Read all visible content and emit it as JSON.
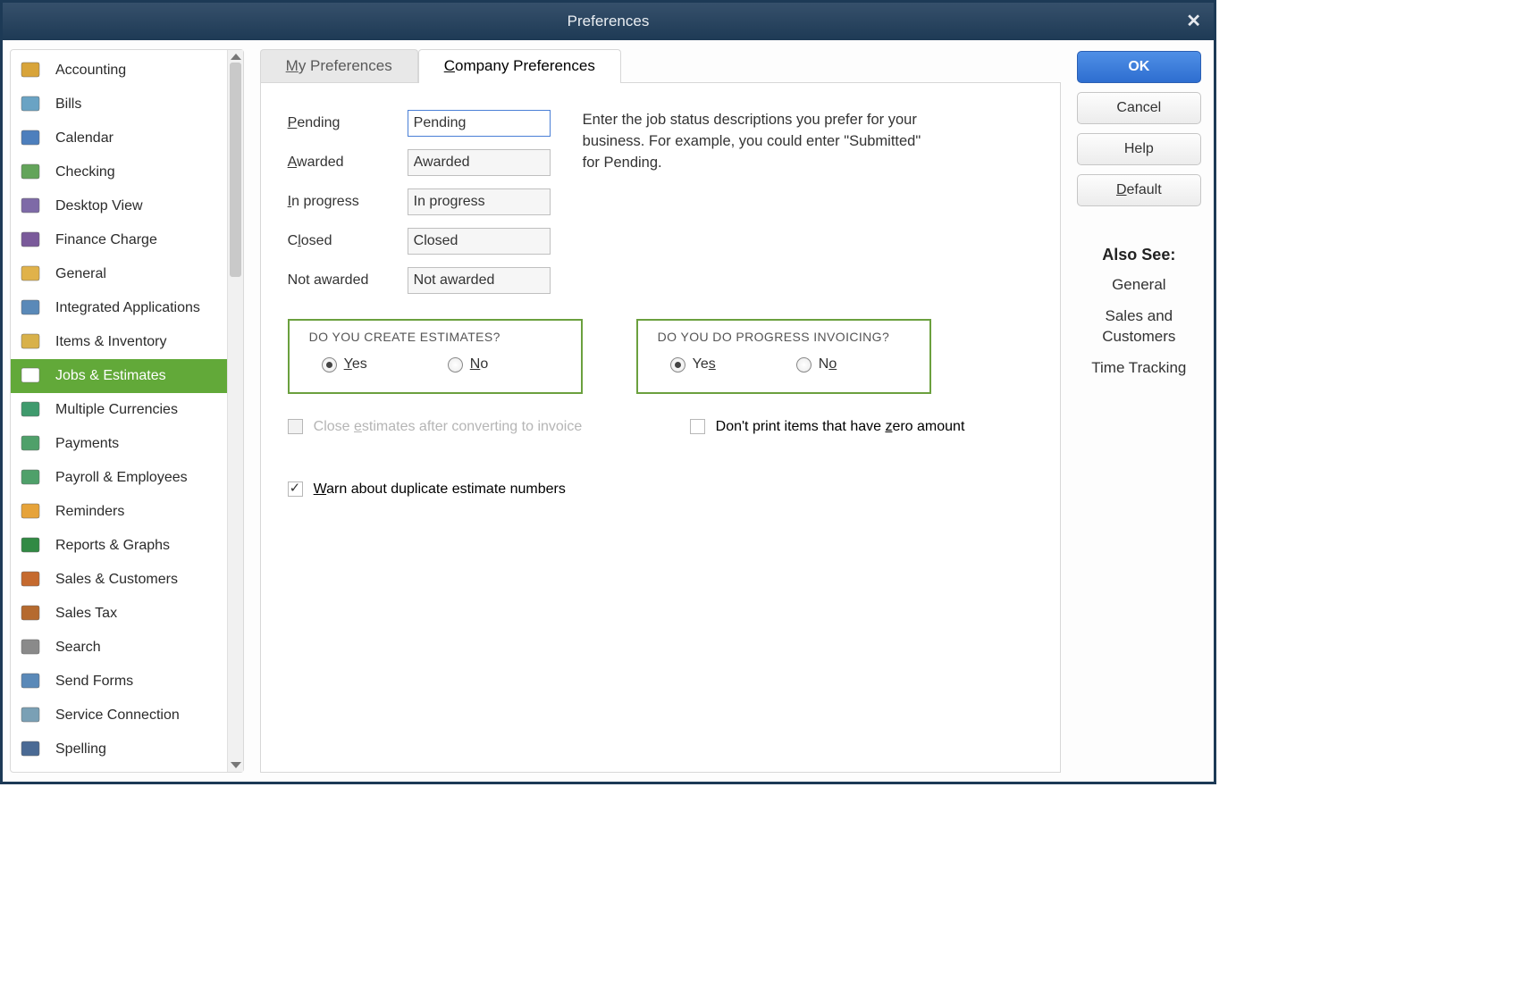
{
  "window": {
    "title": "Preferences"
  },
  "sidebar": {
    "items": [
      {
        "label": "Accounting",
        "icon": "#d8a43a",
        "selected": false
      },
      {
        "label": "Bills",
        "icon": "#6aa3c4",
        "selected": false
      },
      {
        "label": "Calendar",
        "icon": "#4d7fbd",
        "selected": false
      },
      {
        "label": "Checking",
        "icon": "#63a45a",
        "selected": false
      },
      {
        "label": "Desktop View",
        "icon": "#7e6aa7",
        "selected": false
      },
      {
        "label": "Finance Charge",
        "icon": "#7a5a9a",
        "selected": false
      },
      {
        "label": "General",
        "icon": "#e0b24a",
        "selected": false
      },
      {
        "label": "Integrated Applications",
        "icon": "#5a89b8",
        "selected": false
      },
      {
        "label": "Items & Inventory",
        "icon": "#d8b14a",
        "selected": false
      },
      {
        "label": "Jobs & Estimates",
        "icon": "#ffffff",
        "selected": true
      },
      {
        "label": "Multiple Currencies",
        "icon": "#3f9a6d",
        "selected": false
      },
      {
        "label": "Payments",
        "icon": "#4fa06a",
        "selected": false
      },
      {
        "label": "Payroll & Employees",
        "icon": "#4fa06a",
        "selected": false
      },
      {
        "label": "Reminders",
        "icon": "#e6a33a",
        "selected": false
      },
      {
        "label": "Reports & Graphs",
        "icon": "#318a44",
        "selected": false
      },
      {
        "label": "Sales & Customers",
        "icon": "#c56a2f",
        "selected": false
      },
      {
        "label": "Sales Tax",
        "icon": "#b56a2f",
        "selected": false
      },
      {
        "label": "Search",
        "icon": "#8a8a8a",
        "selected": false
      },
      {
        "label": "Send Forms",
        "icon": "#5a89b8",
        "selected": false
      },
      {
        "label": "Service Connection",
        "icon": "#7aa0b5",
        "selected": false
      },
      {
        "label": "Spelling",
        "icon": "#4a6a94",
        "selected": false
      }
    ]
  },
  "tabs": {
    "my": "My Preferences",
    "my_underline": "M",
    "company": "Company Preferences",
    "company_underline": "C",
    "active": "company"
  },
  "status": {
    "helper": "Enter the job status descriptions you prefer for your business.  For example, you could enter \"Submitted\" for Pending.",
    "fields": {
      "pending": {
        "label": "Pending",
        "ul": "P",
        "value": "Pending",
        "focused": true
      },
      "awarded": {
        "label": "Awarded",
        "ul": "A",
        "value": "Awarded"
      },
      "inprogress": {
        "label": "In progress",
        "ul": "I",
        "value": "In progress"
      },
      "closed": {
        "label": "Closed",
        "ul": "l",
        "value": "Closed"
      },
      "notawarded": {
        "label": "Not awarded",
        "ul": "",
        "value": "Not awarded"
      }
    }
  },
  "questions": {
    "estimates": {
      "title": "DO YOU CREATE ESTIMATES?",
      "yes": "Yes",
      "yes_ul": "Y",
      "no": "No",
      "no_ul": "N",
      "value": "yes"
    },
    "progress": {
      "title": "DO YOU DO PROGRESS INVOICING?",
      "yes": "Yes",
      "yes_ul": "s",
      "no": "No",
      "no_ul": "o",
      "value": "yes"
    }
  },
  "checks": {
    "close_estimates": {
      "label_pre": "Close ",
      "label_ul": "e",
      "label_post": "stimates after converting to invoice",
      "checked": false,
      "disabled": true
    },
    "dont_print_zero": {
      "label_pre": "Don't print items that have ",
      "label_ul": "z",
      "label_post": "ero amount",
      "checked": false,
      "disabled": false
    },
    "warn_duplicate": {
      "label_ul": "W",
      "label_post": "arn about duplicate estimate numbers",
      "checked": true,
      "disabled": false
    }
  },
  "right": {
    "ok": "OK",
    "cancel": "Cancel",
    "help": "Help",
    "default": "Default",
    "default_ul": "D",
    "also_see_title": "Also See:",
    "links": [
      "General",
      "Sales and Customers",
      "Time Tracking"
    ]
  }
}
